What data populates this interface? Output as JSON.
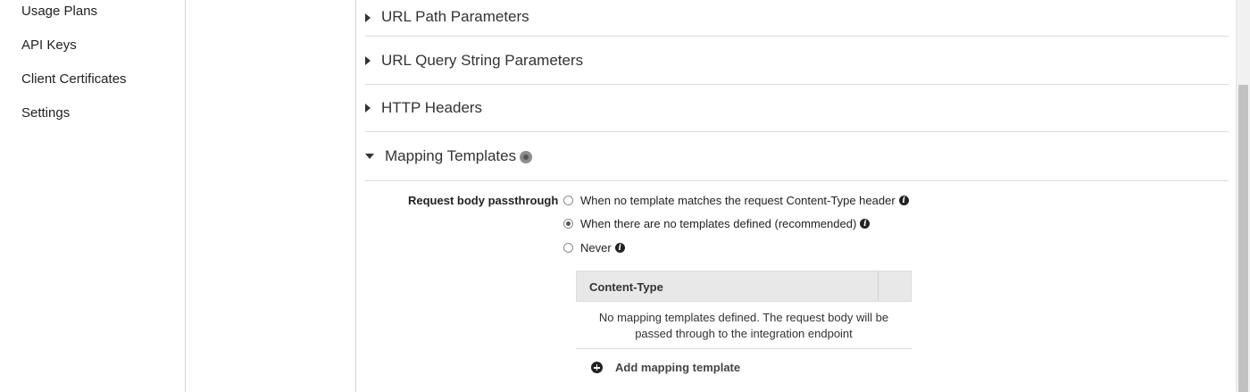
{
  "sidebar": {
    "items": [
      {
        "label": "Usage Plans"
      },
      {
        "label": "API Keys"
      },
      {
        "label": "Client Certificates"
      },
      {
        "label": "Settings"
      }
    ]
  },
  "sections": [
    {
      "title": "URL Path Parameters",
      "expanded": false
    },
    {
      "title": "URL Query String Parameters",
      "expanded": false
    },
    {
      "title": "HTTP Headers",
      "expanded": false
    },
    {
      "title": "Mapping Templates",
      "expanded": true
    }
  ],
  "mapping": {
    "passthrough_label": "Request body passthrough",
    "options": [
      {
        "label": "When no template matches the request Content-Type header",
        "checked": false
      },
      {
        "label": "When there are no templates defined (recommended)",
        "checked": true
      },
      {
        "label": "Never",
        "checked": false
      }
    ],
    "table": {
      "column": "Content-Type",
      "empty_text": "No mapping templates defined. The request body will be passed through to the integration endpoint"
    },
    "add_label": "Add mapping template"
  }
}
